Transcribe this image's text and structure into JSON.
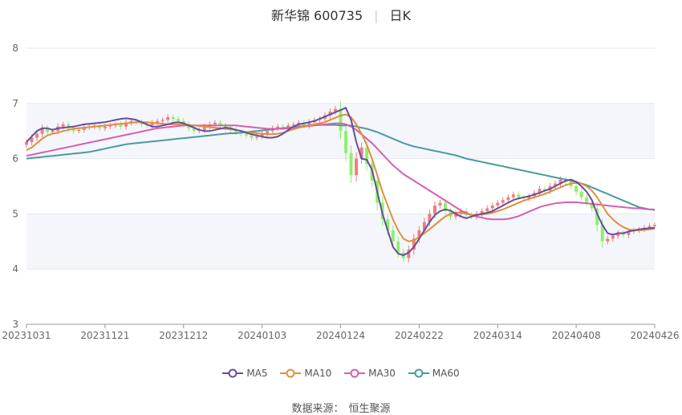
{
  "header": {
    "stock": "新华锦 600735",
    "period": "日K"
  },
  "source": {
    "label": "数据来源：",
    "provider": "恒生聚源"
  },
  "colors": {
    "up": "#f07c7c",
    "down": "#8fef6c",
    "ma5": "#6a4c9c",
    "ma10": "#e0903a",
    "ma30": "#d660b0",
    "ma60": "#4a9ba0"
  },
  "chart_data": {
    "type": "candlestick",
    "ylim": [
      3,
      8
    ],
    "yticks": [
      "3",
      "4",
      "5",
      "6",
      "7",
      "8"
    ],
    "xticks": [
      "20231031",
      "20231121",
      "20231212",
      "20240103",
      "20240124",
      "20240222",
      "20240314",
      "20240408",
      "20240426"
    ],
    "xtick_index": [
      0,
      15,
      30,
      45,
      60,
      75,
      90,
      105,
      120
    ],
    "num_bars": 121,
    "legend": [
      "MA5",
      "MA10",
      "MA30",
      "MA60"
    ],
    "close": [
      6.3,
      6.38,
      6.45,
      6.55,
      6.48,
      6.5,
      6.58,
      6.62,
      6.55,
      6.5,
      6.52,
      6.56,
      6.58,
      6.6,
      6.55,
      6.58,
      6.6,
      6.62,
      6.58,
      6.65,
      6.68,
      6.66,
      6.62,
      6.6,
      6.65,
      6.68,
      6.7,
      6.75,
      6.72,
      6.68,
      6.62,
      6.55,
      6.5,
      6.52,
      6.58,
      6.62,
      6.65,
      6.6,
      6.56,
      6.52,
      6.48,
      6.45,
      6.42,
      6.38,
      6.4,
      6.45,
      6.5,
      6.55,
      6.58,
      6.56,
      6.6,
      6.62,
      6.65,
      6.6,
      6.66,
      6.7,
      6.72,
      6.78,
      6.85,
      6.9,
      6.5,
      6.1,
      5.7,
      6.0,
      6.2,
      5.9,
      5.6,
      5.2,
      4.9,
      4.7,
      4.5,
      4.3,
      4.2,
      4.35,
      4.55,
      4.7,
      4.85,
      5.0,
      5.15,
      5.2,
      5.05,
      4.95,
      5.0,
      5.05,
      4.98,
      4.95,
      5.0,
      5.05,
      5.1,
      5.15,
      5.2,
      5.25,
      5.3,
      5.35,
      5.3,
      5.28,
      5.32,
      5.38,
      5.45,
      5.42,
      5.5,
      5.55,
      5.62,
      5.58,
      5.5,
      5.4,
      5.3,
      5.2,
      5.1,
      4.8,
      4.5,
      4.55,
      4.6,
      4.65,
      4.62,
      4.68,
      4.7,
      4.72,
      4.75,
      4.78,
      4.8
    ],
    "ma5": [
      6.3,
      6.4,
      6.5,
      6.55,
      6.55,
      6.52,
      6.55,
      6.56,
      6.57,
      6.58,
      6.6,
      6.62,
      6.63,
      6.64,
      6.65,
      6.66,
      6.68,
      6.7,
      6.72,
      6.73,
      6.72,
      6.7,
      6.66,
      6.62,
      6.58,
      6.58,
      6.6,
      6.62,
      6.65,
      6.66,
      6.64,
      6.6,
      6.56,
      6.52,
      6.5,
      6.5,
      6.52,
      6.54,
      6.56,
      6.55,
      6.52,
      6.5,
      6.47,
      6.44,
      6.42,
      6.4,
      6.38,
      6.38,
      6.4,
      6.45,
      6.52,
      6.58,
      6.62,
      6.64,
      6.66,
      6.68,
      6.72,
      6.76,
      6.8,
      6.84,
      6.88,
      6.92,
      6.7,
      6.3,
      6.0,
      5.98,
      5.8,
      5.4,
      5.0,
      4.7,
      4.4,
      4.28,
      4.25,
      4.3,
      4.4,
      4.55,
      4.7,
      4.85,
      4.98,
      5.05,
      5.08,
      5.06,
      5.0,
      4.95,
      4.92,
      4.95,
      4.98,
      5.0,
      5.02,
      5.05,
      5.1,
      5.15,
      5.2,
      5.25,
      5.28,
      5.3,
      5.32,
      5.35,
      5.38,
      5.42,
      5.45,
      5.5,
      5.55,
      5.6,
      5.62,
      5.58,
      5.5,
      5.4,
      5.25,
      5.0,
      4.8,
      4.65,
      4.62,
      4.65,
      4.65,
      4.68,
      4.7,
      4.72,
      4.73,
      4.74,
      4.75
    ],
    "ma10": [
      6.15,
      6.2,
      6.28,
      6.36,
      6.42,
      6.45,
      6.47,
      6.5,
      6.52,
      6.54,
      6.55,
      6.56,
      6.57,
      6.58,
      6.59,
      6.6,
      6.61,
      6.62,
      6.63,
      6.64,
      6.65,
      6.66,
      6.66,
      6.66,
      6.65,
      6.64,
      6.63,
      6.62,
      6.62,
      6.62,
      6.62,
      6.61,
      6.6,
      6.59,
      6.58,
      6.57,
      6.56,
      6.55,
      6.54,
      6.53,
      6.52,
      6.5,
      6.48,
      6.47,
      6.46,
      6.45,
      6.44,
      6.44,
      6.45,
      6.47,
      6.5,
      6.53,
      6.56,
      6.58,
      6.6,
      6.62,
      6.64,
      6.66,
      6.7,
      6.74,
      6.78,
      6.8,
      6.75,
      6.62,
      6.45,
      6.25,
      6.0,
      5.7,
      5.4,
      5.15,
      4.9,
      4.7,
      4.55,
      4.5,
      4.52,
      4.58,
      4.65,
      4.72,
      4.8,
      4.88,
      4.95,
      5.0,
      5.02,
      5.02,
      5.0,
      4.98,
      4.98,
      4.99,
      5.0,
      5.02,
      5.05,
      5.08,
      5.12,
      5.16,
      5.2,
      5.24,
      5.27,
      5.3,
      5.33,
      5.36,
      5.4,
      5.44,
      5.48,
      5.52,
      5.55,
      5.56,
      5.55,
      5.5,
      5.42,
      5.3,
      5.15,
      5.0,
      4.9,
      4.82,
      4.76,
      4.72,
      4.7,
      4.7,
      4.71,
      4.72,
      4.73
    ],
    "ma30": [
      6.05,
      6.07,
      6.09,
      6.11,
      6.13,
      6.15,
      6.17,
      6.19,
      6.21,
      6.23,
      6.25,
      6.27,
      6.29,
      6.31,
      6.33,
      6.35,
      6.37,
      6.39,
      6.41,
      6.43,
      6.45,
      6.47,
      6.49,
      6.51,
      6.53,
      6.55,
      6.56,
      6.57,
      6.58,
      6.59,
      6.6,
      6.6,
      6.6,
      6.6,
      6.6,
      6.6,
      6.6,
      6.6,
      6.6,
      6.6,
      6.6,
      6.59,
      6.58,
      6.57,
      6.56,
      6.55,
      6.54,
      6.54,
      6.54,
      6.54,
      6.55,
      6.56,
      6.57,
      6.58,
      6.59,
      6.6,
      6.61,
      6.62,
      6.63,
      6.64,
      6.64,
      6.62,
      6.58,
      6.52,
      6.44,
      6.36,
      6.28,
      6.18,
      6.08,
      5.98,
      5.88,
      5.8,
      5.72,
      5.66,
      5.6,
      5.54,
      5.48,
      5.42,
      5.36,
      5.3,
      5.24,
      5.18,
      5.12,
      5.06,
      5.02,
      4.98,
      4.95,
      4.93,
      4.91,
      4.9,
      4.9,
      4.9,
      4.91,
      4.93,
      4.96,
      5.0,
      5.04,
      5.08,
      5.12,
      5.15,
      5.17,
      5.19,
      5.2,
      5.21,
      5.21,
      5.21,
      5.2,
      5.19,
      5.18,
      5.17,
      5.16,
      5.15,
      5.14,
      5.13,
      5.12,
      5.11,
      5.1,
      5.1,
      5.09,
      5.08,
      5.08
    ],
    "ma60": [
      6.0,
      6.01,
      6.02,
      6.03,
      6.04,
      6.05,
      6.06,
      6.07,
      6.08,
      6.09,
      6.1,
      6.11,
      6.12,
      6.14,
      6.16,
      6.18,
      6.2,
      6.22,
      6.24,
      6.26,
      6.27,
      6.28,
      6.29,
      6.3,
      6.31,
      6.32,
      6.33,
      6.34,
      6.35,
      6.36,
      6.37,
      6.38,
      6.39,
      6.4,
      6.41,
      6.42,
      6.43,
      6.44,
      6.45,
      6.46,
      6.46,
      6.47,
      6.48,
      6.49,
      6.5,
      6.51,
      6.52,
      6.53,
      6.54,
      6.55,
      6.56,
      6.57,
      6.58,
      6.59,
      6.6,
      6.61,
      6.61,
      6.61,
      6.61,
      6.61,
      6.6,
      6.6,
      6.6,
      6.58,
      6.56,
      6.54,
      6.51,
      6.48,
      6.44,
      6.4,
      6.36,
      6.32,
      6.28,
      6.25,
      6.22,
      6.2,
      6.18,
      6.16,
      6.14,
      6.12,
      6.1,
      6.08,
      6.06,
      6.03,
      6.0,
      5.98,
      5.96,
      5.94,
      5.92,
      5.9,
      5.88,
      5.86,
      5.84,
      5.82,
      5.8,
      5.78,
      5.76,
      5.74,
      5.72,
      5.7,
      5.68,
      5.66,
      5.64,
      5.62,
      5.6,
      5.58,
      5.55,
      5.52,
      5.48,
      5.44,
      5.4,
      5.36,
      5.32,
      5.28,
      5.24,
      5.2,
      5.16,
      5.12,
      5.1,
      5.08,
      5.07
    ]
  }
}
